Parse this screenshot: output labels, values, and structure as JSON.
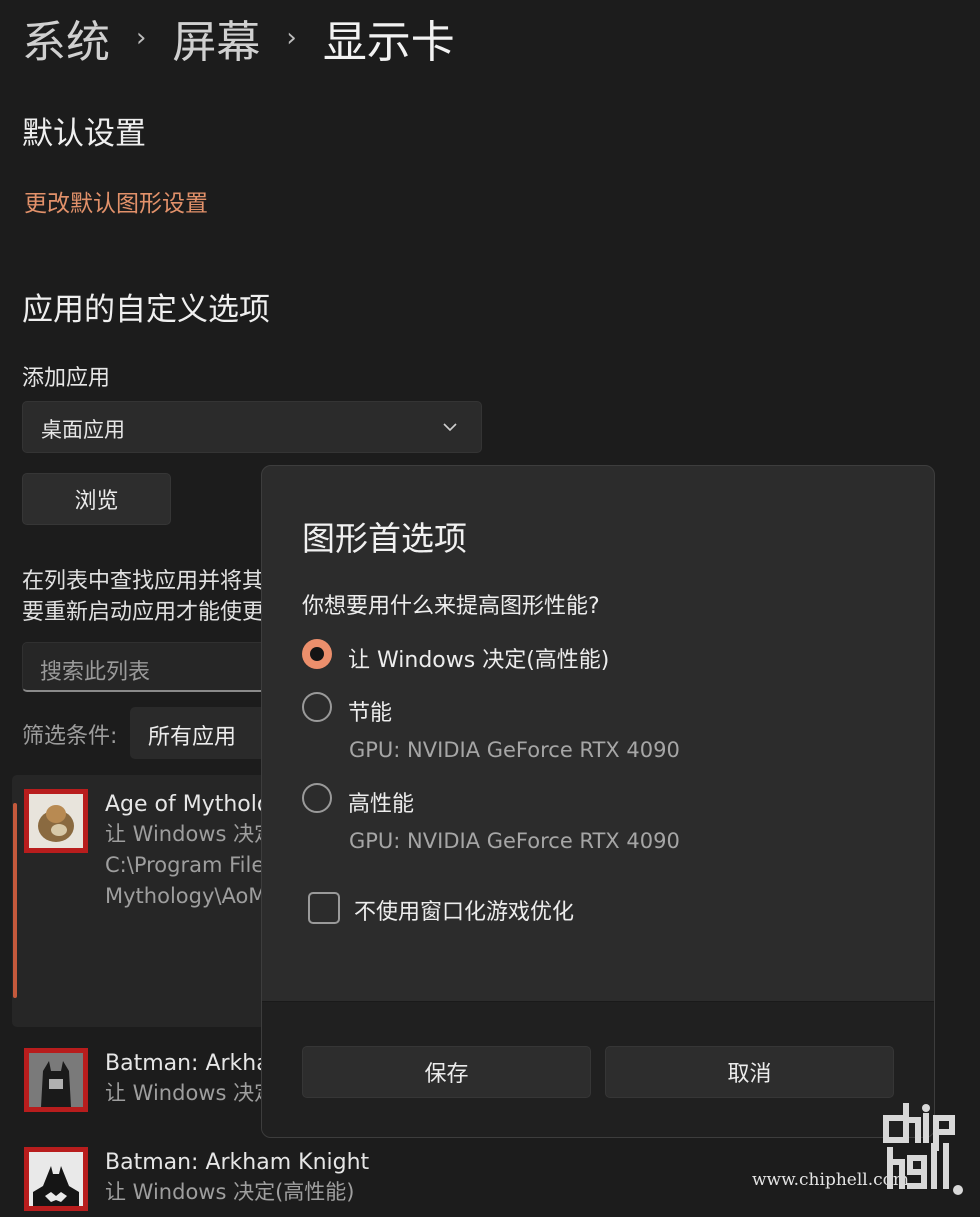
{
  "breadcrumb": {
    "items": [
      "系统",
      "屏幕",
      "显示卡"
    ],
    "separator": "›"
  },
  "default_settings": {
    "title": "默认设置",
    "link": "更改默认图形设置"
  },
  "custom_options": {
    "title": "应用的自定义选项",
    "add_app_label": "添加应用",
    "dropdown_value": "桌面应用",
    "browse_button": "浏览",
    "description": "在列表中查找应用并将其...要重新启动应用才能使更改...",
    "description_line1": "在列表中查找应用并将其",
    "description_line2": "要重新启动应用才能使更",
    "search_placeholder": "搜索此列表",
    "filter_label": "筛选条件:",
    "filter_value": "所有应用"
  },
  "apps": [
    {
      "name": "Age of Mytholo",
      "sub": "让 Windows 决定",
      "path1": "C:\\Program File",
      "path2": "Mythology\\AoM",
      "icon": "age-of-mythology-icon"
    },
    {
      "name": "Batman: Arkhan",
      "sub": "让 Windows 决定",
      "icon": "batman-arkham-icon"
    },
    {
      "name": "Batman: Arkham Knight",
      "sub": "让 Windows 决定(高性能)",
      "icon": "batman-arkham-knight-icon"
    }
  ],
  "dialog": {
    "title": "图形首选项",
    "question": "你想要用什么来提高图形性能?",
    "options": [
      {
        "label": "让 Windows 决定(高性能)",
        "selected": true,
        "sub": ""
      },
      {
        "label": "节能",
        "selected": false,
        "sub": "GPU: NVIDIA GeForce RTX 4090"
      },
      {
        "label": "高性能",
        "selected": false,
        "sub": "GPU: NVIDIA GeForce RTX 4090"
      }
    ],
    "checkbox_label": "不使用窗口化游戏优化",
    "checkbox_checked": false,
    "save_button": "保存",
    "cancel_button": "取消"
  },
  "watermark": {
    "text": "www.chiphell.com",
    "logo": "chiphell-logo-icon"
  },
  "colors": {
    "accent": "#ec8f6c",
    "link": "#e2916a",
    "background": "#1c1c1c",
    "dialog": "#2c2c2c"
  }
}
